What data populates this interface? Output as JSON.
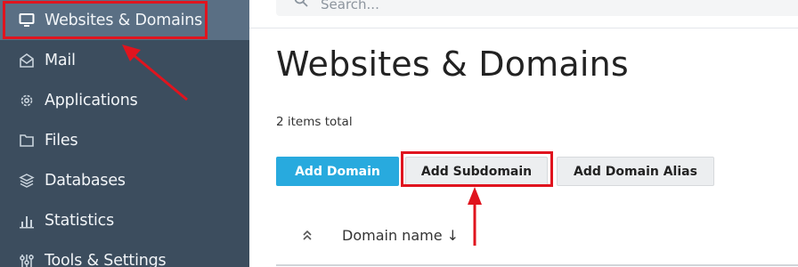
{
  "sidebar": {
    "items": [
      {
        "label": "Websites & Domains",
        "icon": "monitor-icon",
        "active": true
      },
      {
        "label": "Mail",
        "icon": "envelope-icon"
      },
      {
        "label": "Applications",
        "icon": "gear-icon"
      },
      {
        "label": "Files",
        "icon": "folder-icon"
      },
      {
        "label": "Databases",
        "icon": "database-icon"
      },
      {
        "label": "Statistics",
        "icon": "bar-chart-icon"
      },
      {
        "label": "Tools & Settings",
        "icon": "sliders-icon"
      }
    ]
  },
  "search": {
    "placeholder": "Search..."
  },
  "main": {
    "title": "Websites & Domains",
    "items_total": "2 items total",
    "buttons": {
      "add_domain": "Add Domain",
      "add_subdomain": "Add Subdomain",
      "add_domain_alias": "Add Domain Alias"
    },
    "table": {
      "columns": [
        "Domain name ↓"
      ]
    }
  },
  "colors": {
    "sidebar_bg": "#3c4d5e",
    "sidebar_active": "#5a6f84",
    "primary_button": "#28aade",
    "annotation_red": "#e0141e"
  }
}
